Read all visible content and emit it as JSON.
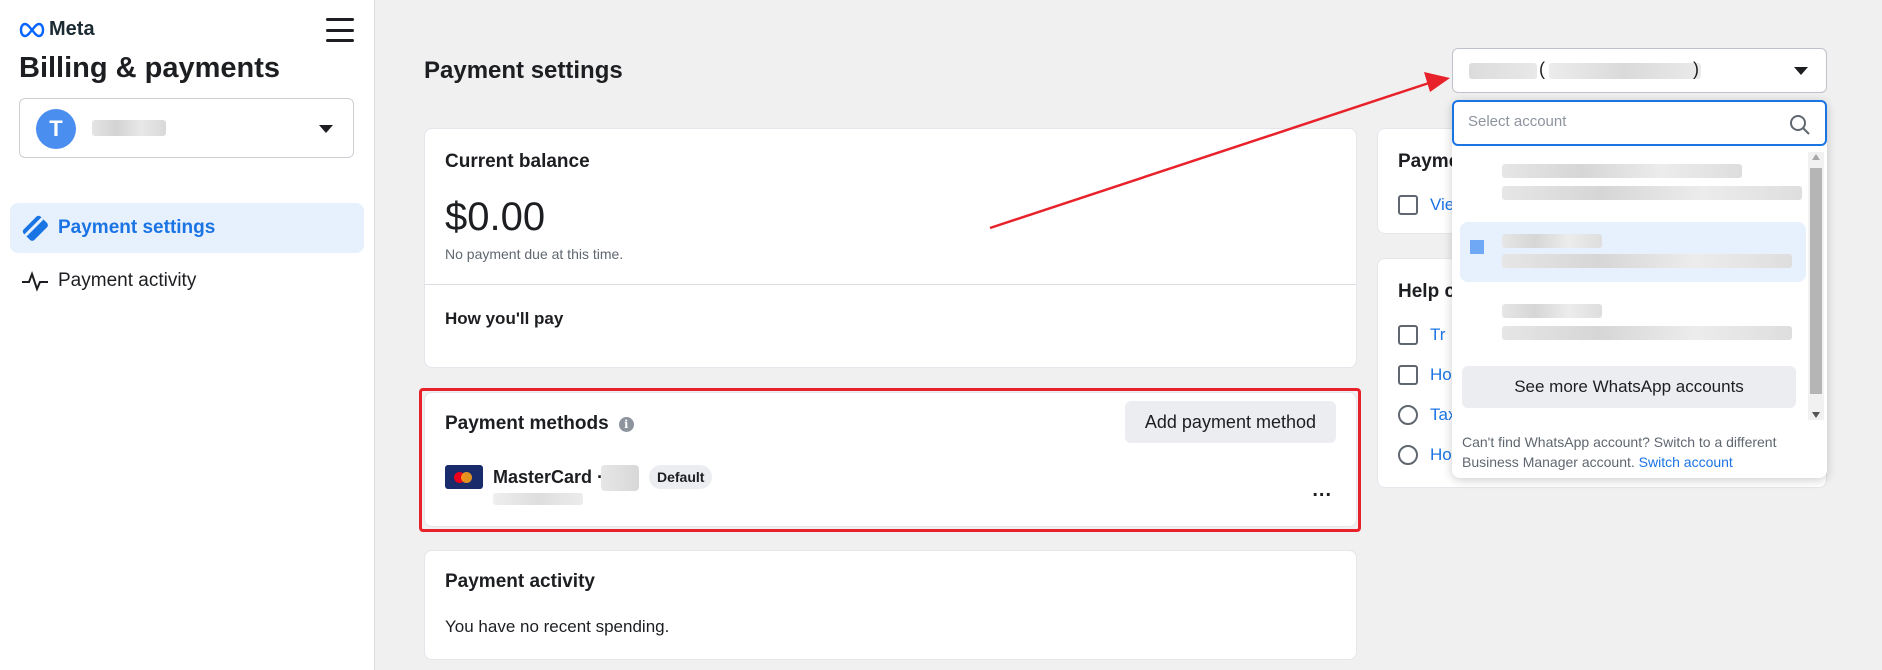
{
  "brand": {
    "logo_text": "Meta"
  },
  "sidebar": {
    "title": "Billing & payments",
    "account": {
      "avatar_letter": "T"
    },
    "items": [
      {
        "label": "Payment settings",
        "active": true,
        "icon": "card-icon"
      },
      {
        "label": "Payment activity",
        "active": false,
        "icon": "activity-icon"
      }
    ]
  },
  "main": {
    "title": "Payment settings",
    "balance": {
      "title": "Current balance",
      "amount": "$0.00",
      "note": "No payment due at this time.",
      "how_pay": "How you'll pay"
    },
    "methods": {
      "title": "Payment methods",
      "add_label": "Add payment method",
      "card_label": "MasterCard ·",
      "default_badge": "Default",
      "more_label": "..."
    },
    "activity": {
      "title": "Payment activity",
      "note": "You have no recent spending."
    }
  },
  "right": {
    "card1_title": "Payme",
    "card1_link": "Vie",
    "card2_title": "Help c",
    "card2_links": [
      "Tr",
      "Ho",
      "Tax",
      "Ho"
    ]
  },
  "account_dropdown": {
    "trigger_open_paren": "(",
    "trigger_close_paren": ")",
    "search_placeholder": "Select account",
    "see_more_label": "See more WhatsApp accounts",
    "cant_find_text": "Can't find WhatsApp account? Switch to a different Business Manager account.",
    "switch_link": "Switch account"
  },
  "colors": {
    "accent": "#1b74e4",
    "annotation_red": "#e8222a",
    "selected_bg": "#e7f0fd"
  }
}
